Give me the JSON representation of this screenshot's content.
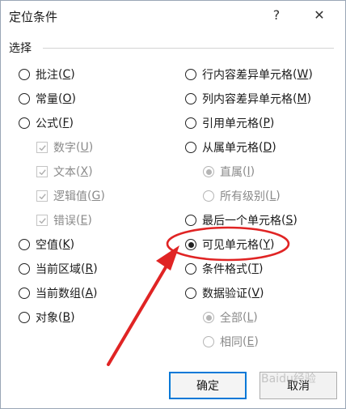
{
  "window": {
    "title": "定位条件",
    "help": "?",
    "close": "✕"
  },
  "group": {
    "label": "选择"
  },
  "left": [
    {
      "label": "批注",
      "key": "C"
    },
    {
      "label": "常量",
      "key": "O"
    },
    {
      "label": "公式",
      "key": "F"
    },
    {
      "label": "数字",
      "key": "U"
    },
    {
      "label": "文本",
      "key": "X"
    },
    {
      "label": "逻辑值",
      "key": "G"
    },
    {
      "label": "错误",
      "key": "E"
    },
    {
      "label": "空值",
      "key": "K"
    },
    {
      "label": "当前区域",
      "key": "R"
    },
    {
      "label": "当前数组",
      "key": "A"
    },
    {
      "label": "对象",
      "key": "B"
    }
  ],
  "right": [
    {
      "label": "行内容差异单元格",
      "key": "W"
    },
    {
      "label": "列内容差异单元格",
      "key": "M"
    },
    {
      "label": "引用单元格",
      "key": "P"
    },
    {
      "label": "从属单元格",
      "key": "D"
    },
    {
      "label": "直属",
      "key": "I"
    },
    {
      "label": "所有级别",
      "key": "L"
    },
    {
      "label": "最后一个单元格",
      "key": "S"
    },
    {
      "label": "可见单元格",
      "key": "Y"
    },
    {
      "label": "条件格式",
      "key": "T"
    },
    {
      "label": "数据验证",
      "key": "V"
    },
    {
      "label": "全部",
      "key": "L"
    },
    {
      "label": "相同",
      "key": "E"
    }
  ],
  "buttons": {
    "ok": "确定",
    "cancel": "取消"
  },
  "watermark": "Baidu经验",
  "colors": {
    "annotation": "#e02424",
    "default_button_border": "#0078d7"
  },
  "selected": "可见单元格"
}
